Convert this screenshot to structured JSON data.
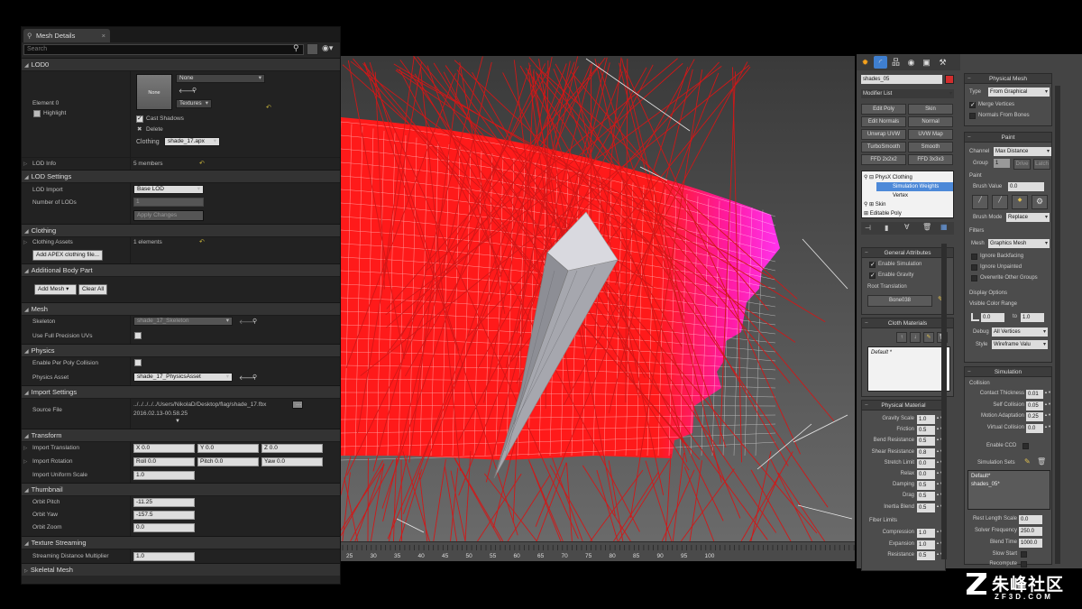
{
  "details": {
    "tab_title": "Mesh Details",
    "search_placeholder": "Search",
    "sections": {
      "lod0": "LOD0",
      "lod_settings": "LOD Settings",
      "clothing": "Clothing",
      "additional_body_part": "Additional Body Part",
      "mesh": "Mesh",
      "physics": "Physics",
      "import_settings": "Import Settings",
      "transform": "Transform",
      "thumbnail": "Thumbnail",
      "texture_streaming": "Texture Streaming",
      "skeletal_mesh": "Skeletal Mesh"
    },
    "lod0": {
      "element_label": "Element 0",
      "highlight_label": "Highlight",
      "thumb_label": "None",
      "material_value": "None",
      "textures_label": "Textures",
      "cast_shadows_label": "Cast Shadows",
      "delete_label": "Delete",
      "clothing_label": "Clothing",
      "clothing_value": "shade_17.apx",
      "lod_info_label": "LOD Info",
      "lod_info_value": "5 members"
    },
    "lod_settings": {
      "lod_import_label": "LOD Import",
      "lod_import_value": "Base LOD",
      "num_lods_label": "Number of LODs",
      "num_lods_value": "1",
      "apply_label": "Apply Changes"
    },
    "clothing": {
      "assets_label": "Clothing Assets",
      "assets_value": "1 elements",
      "add_apex_label": "Add APEX clothing file..."
    },
    "body_part": {
      "add_mesh_label": "Add Mesh",
      "clear_all_label": "Clear All"
    },
    "mesh": {
      "skeleton_label": "Skeleton",
      "skeleton_value": "shade_17_Skeleton",
      "full_uv_label": "Use Full Precision UVs"
    },
    "physics": {
      "per_poly_label": "Enable Per Poly Collision",
      "asset_label": "Physics Asset",
      "asset_value": "shade_17_PhysicsAsset"
    },
    "import": {
      "source_label": "Source File",
      "source_path": "../../../../../Users/NikolaD/Desktop/flag/shade_17.fbx",
      "source_date": "2016.02.13-00.58.25"
    },
    "transform": {
      "translation_label": "Import Translation",
      "tx": "X  0.0",
      "ty": "Y  0.0",
      "tz": "Z  0.0",
      "rotation_label": "Import Rotation",
      "roll": "Roll  0.0",
      "pitch": "Pitch  0.0",
      "yaw": "Yaw  0.0",
      "scale_label": "Import Uniform Scale",
      "scale_value": "1.0"
    },
    "thumbnail": {
      "pitch_label": "Orbit Pitch",
      "pitch_value": "-11.25",
      "yaw_label": "Orbit Yaw",
      "yaw_value": "-157.5",
      "zoom_label": "Orbit Zoom",
      "zoom_value": "0.0"
    },
    "streaming": {
      "mult_label": "Streaming Distance Multiplier",
      "mult_value": "1.0"
    }
  },
  "max": {
    "object_name": "shades_05",
    "modifier_list": "Modifier List",
    "mod_buttons": [
      "Edit Poly",
      "Skin",
      "Edit Normals",
      "Normal",
      "Unwrap UVW",
      "UVW Map",
      "TurboSmooth",
      "Smooth",
      "FFD 2x2x2",
      "FFD 3x3x3"
    ],
    "stack": {
      "physx": "PhysX Clothing",
      "sim_weights": "Simulation Weights",
      "vertex": "Vertex",
      "skin": "Skin",
      "editable_poly": "Editable Poly"
    },
    "general": {
      "title": "General Attributes",
      "enable_sim": "Enable Simulation",
      "enable_grav": "Enable Gravity",
      "root_label": "Root Translation",
      "root_bone": "Bone038"
    },
    "cloth_materials": {
      "title": "Cloth Materials",
      "default_item": "Default *"
    },
    "physical_material": {
      "title": "Physical Material",
      "rows": [
        {
          "label": "Gravity Scale",
          "value": "1.0"
        },
        {
          "label": "Friction",
          "value": "0.5"
        },
        {
          "label": "Bend Resistance",
          "value": "0.5"
        },
        {
          "label": "Shear Resistance",
          "value": "0.8"
        },
        {
          "label": "Stretch Limit",
          "value": "0.0"
        },
        {
          "label": "Relax",
          "value": "0.0"
        },
        {
          "label": "Damping",
          "value": "0.5"
        },
        {
          "label": "Drag",
          "value": "0.5"
        },
        {
          "label": "Inertia Blend",
          "value": "0.5"
        }
      ],
      "fiber_title": "Fiber Limits",
      "fiber_rows": [
        {
          "label": "Compression",
          "value": "1.0"
        },
        {
          "label": "Expansion",
          "value": "1.0"
        },
        {
          "label": "Resistance",
          "value": "0.5"
        }
      ]
    },
    "physical_mesh": {
      "title": "Physical Mesh",
      "type_label": "Type",
      "type_value": "From Graphical",
      "merge_label": "Merge Vertices",
      "normals_label": "Normals From Bones"
    },
    "paint": {
      "title": "Paint",
      "channel_label": "Channel",
      "channel_value": "Max Distance",
      "group_label": "Group",
      "group_value": "1",
      "drive_label": "Drive",
      "latch_label": "Latch",
      "paint_label": "Paint",
      "brush_value_label": "Brush Value",
      "brush_value": "0.0",
      "brush_mode_label": "Brush Mode",
      "brush_mode_value": "Replace",
      "filters_label": "Filters",
      "mesh_label": "Mesh",
      "mesh_value": "Graphics Mesh",
      "ignore_backfacing": "Ignore Backfacing",
      "ignore_unpainted": "Ignore Unpainted",
      "overwrite_groups": "Overwrite Other Groups",
      "display_options": "Display Options",
      "visible_range": "Visible Color Range",
      "range_min": "0.0",
      "to_label": "to",
      "range_max": "1.0",
      "debug_label": "Debug",
      "debug_value": "All Vertices",
      "style_label": "Style",
      "style_value": "Wireframe Valu"
    },
    "simulation": {
      "title": "Simulation",
      "collision_label": "Collision",
      "rows": [
        {
          "label": "Contact Thickness",
          "value": "0.01"
        },
        {
          "label": "Self Collision",
          "value": "0.05"
        },
        {
          "label": "Motion Adaptation",
          "value": "0.25"
        },
        {
          "label": "Virtual Collision",
          "value": "0.0"
        }
      ],
      "enable_ccd": "Enable CCD",
      "sim_sets_label": "Simulation Sets",
      "sim_sets": [
        "Default*",
        "shades_05*"
      ],
      "rest_length_label": "Rest Length Scale",
      "rest_length_value": "0.0",
      "solver_freq_label": "Solver Frequency",
      "solver_freq_value": "250.0",
      "blend_time_label": "Blend Time",
      "blend_time_value": "1000.0",
      "slow_start_label": "Slow Start",
      "recompute_label": "Recompute"
    }
  },
  "timeline": {
    "ticks": [
      "25",
      "30",
      "35",
      "40",
      "45",
      "50",
      "55",
      "60",
      "65",
      "70",
      "75",
      "80",
      "85",
      "90",
      "95",
      "100"
    ]
  },
  "watermark": {
    "cn": "朱峰社区",
    "en": "ZF3D.COM"
  },
  "colors": {
    "cloth": "#ff1a1a",
    "cloth_highlight": "#ff22cc",
    "viewport_bg": "#4a4a4a",
    "selection_blue": "#4d89d8"
  }
}
